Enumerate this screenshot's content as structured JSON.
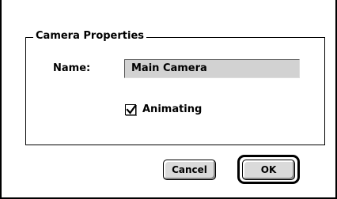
{
  "dialog": {
    "group_title": "Camera Properties",
    "name_label": "Name:",
    "name_value": "Main Camera",
    "animating_label": "Animating",
    "animating_checked": true,
    "cancel_label": "Cancel",
    "ok_label": "OK"
  },
  "icons": {
    "checkbox_mark": "checkmark-icon"
  },
  "colors": {
    "field_background": "#d2d2d2",
    "button_face": "#dadada"
  }
}
